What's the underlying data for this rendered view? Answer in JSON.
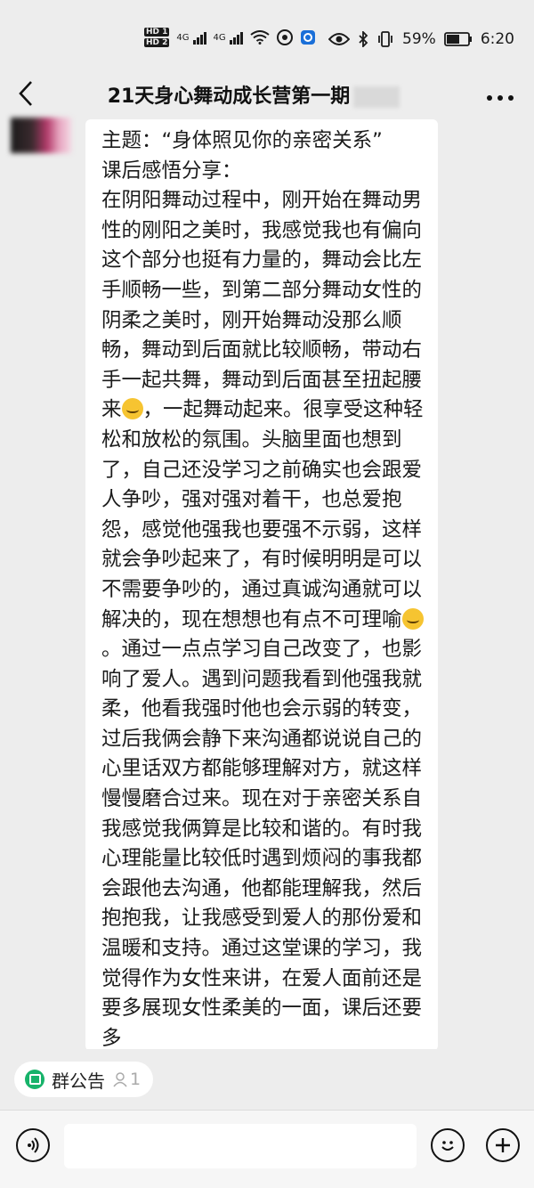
{
  "status_bar": {
    "hd1": "HD 1",
    "hd2": "HD 2",
    "net1": "4G",
    "net2": "4G",
    "battery_percent": "59%",
    "time": "6:20"
  },
  "header": {
    "title": "21天身心舞动成长营第一期",
    "back_icon": "chevron-left-icon",
    "more_icon": "more-dots-icon"
  },
  "message": {
    "segments": [
      "主题：“身体照见你的亲密关系”\n课后感悟分享：\n在阴阳舞动过程中，刚开始在舞动男性的刚阳之美时，我感觉我也有偏向这个部分也挺有力量的，舞动会比左手顺畅一些，到第二部分舞动女性的阴柔之美时，刚开始舞动没那么顺畅，舞动到后面就比较顺畅，带动右手一起共舞，舞动到后面甚至扭起腰来",
      "，一起舞动起来。很享受这种轻松和放松的氛围。头脑里面也想到了，自己还没学习之前确实也会跟爱人争吵，强对强对着干，也总爱抱怨，感觉他强我也要强不示弱，这样就会争吵起来了，有时候明明是可以不需要争吵的，通过真诚沟通就可以解决的，现在想想也有点不可理喻",
      "。通过一点点学习自己改变了，也影响了爱人。遇到问题我看到他强我就柔，他看我强时他也会示弱的转变，过后我俩会静下来沟通都说说自己的心里话双方都能够理解对方，就这样慢慢磨合过来。现在对于亲密关系自我感觉我俩算是比较和谐的。有时我心理能量比较低时遇到烦闷的事我都会跟他去沟通，他都能理解我，然后抱抱我，让我感受到爱人的那份爱和温暖和支持。通过这堂课的学习，我觉得作为女性来讲，在爱人面前还是要多展现女性柔美的一面，课后还要多"
    ],
    "emoji_icon": "laughing-tears-emoji"
  },
  "notice": {
    "label": "群公告",
    "count": "1",
    "icon": "group-notice-icon",
    "person_icon": "person-icon"
  },
  "input_bar": {
    "voice_icon": "voice-icon",
    "emoji_icon": "smiley-icon",
    "plus_icon": "plus-icon",
    "placeholder": ""
  }
}
